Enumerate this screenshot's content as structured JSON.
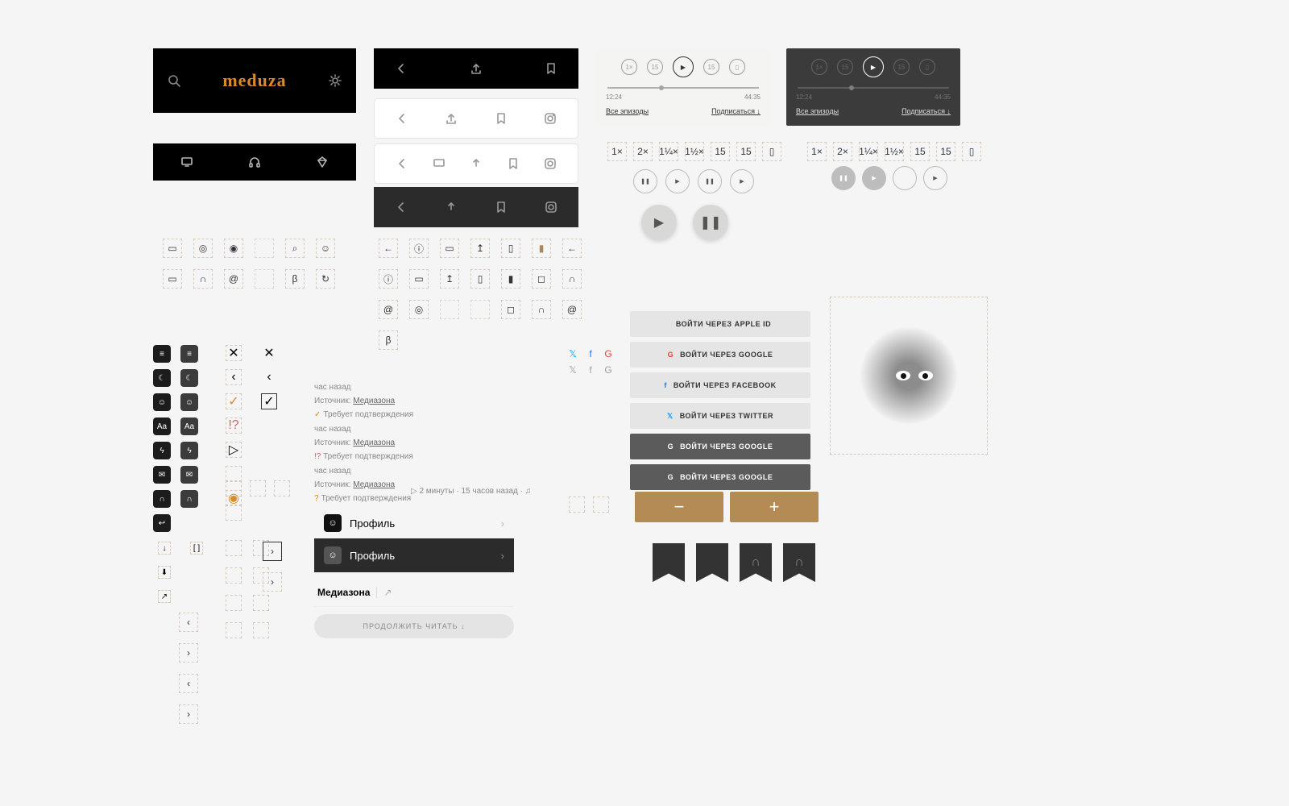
{
  "brand": {
    "logo_text": "meduza"
  },
  "player": {
    "time_current": "12:24",
    "time_total": "44:35",
    "all_episodes": "Все эпизоды",
    "subscribe": "Подписаться ↓",
    "speeds": [
      "1×",
      "2×",
      "1¼×",
      "1½×"
    ],
    "skip_back": "15",
    "skip_fwd": "15"
  },
  "meta": {
    "hour_ago": "час назад",
    "source_label": "Источник:",
    "source_name": "Медиазона",
    "verify_ok": "Требует подтверждения",
    "verify_warn": "Требует подтверждения",
    "duration": "▷ 2 минуты",
    "time_ago": "15 часов назад",
    "listen": "♫"
  },
  "profile": {
    "label1": "Профиль",
    "label2": "Профиль",
    "source_row": "Медиазона"
  },
  "continue_button": "ПРОДОЛЖИТЬ ЧИТАТЬ ↓",
  "login": {
    "apple": "ВОЙТИ ЧЕРЕЗ APPLE ID",
    "google": "ВОЙТИ ЧЕРЕЗ GOOGLE",
    "facebook": "ВОЙТИ ЧЕРЕЗ FACEBOOK",
    "twitter": "ВОЙТИ ЧЕРЕЗ TWITTER",
    "google2": "ВОЙТИ ЧЕРЕЗ GOOGLE",
    "google3": "ВОЙТИ ЧЕРЕЗ GOOGLE"
  },
  "stepper": {
    "minus": "−",
    "plus": "+"
  },
  "icons": {
    "aa": "Aa",
    "beta": "β",
    "speed_labels": [
      "1×",
      "2×",
      "1¼×",
      "1½×",
      "15",
      "15"
    ]
  }
}
